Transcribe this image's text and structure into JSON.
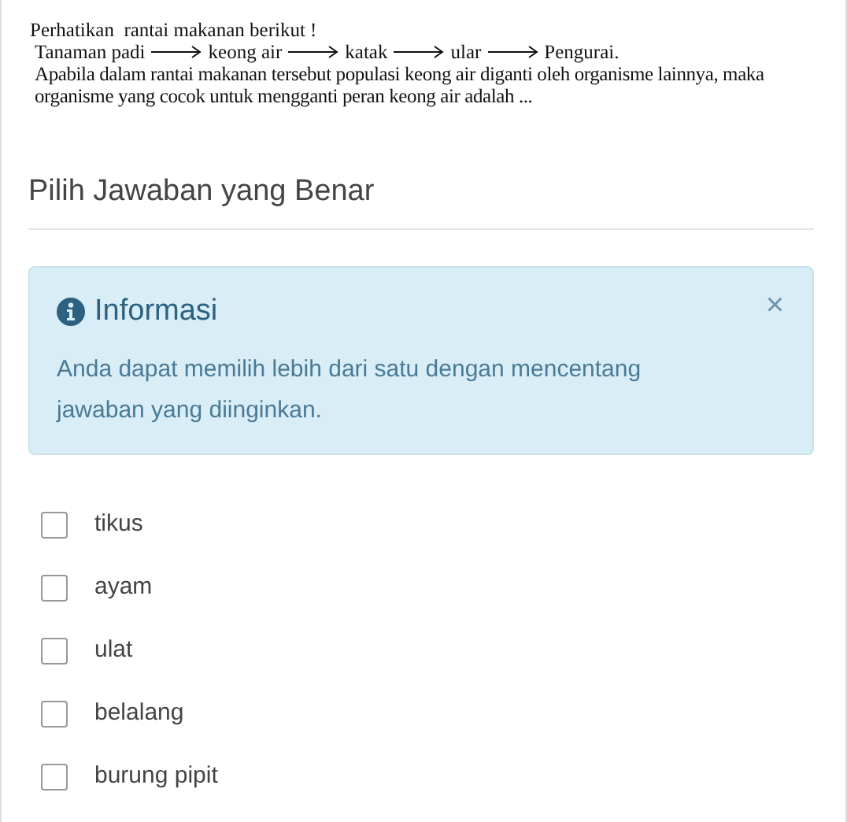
{
  "question": {
    "intro": "Perhatikan  rantai makanan berikut !",
    "chain": [
      "Tanaman padi",
      "keong air",
      "katak",
      "ular",
      "Pengurai."
    ],
    "text": "Apabila dalam rantai makanan tersebut populasi keong air diganti oleh organisme lainnya, maka organisme yang cocok untuk mengganti peran keong air adalah ..."
  },
  "heading": "Pilih Jawaban yang Benar",
  "alert": {
    "title": "Informasi",
    "close": "×",
    "text": "Anda dapat memilih lebih dari satu dengan mencentang jawaban yang diinginkan."
  },
  "options": [
    {
      "label": "tikus",
      "checked": false
    },
    {
      "label": "ayam",
      "checked": false
    },
    {
      "label": "ulat",
      "checked": false
    },
    {
      "label": "belalang",
      "checked": false
    },
    {
      "label": "burung pipit",
      "checked": false
    }
  ]
}
